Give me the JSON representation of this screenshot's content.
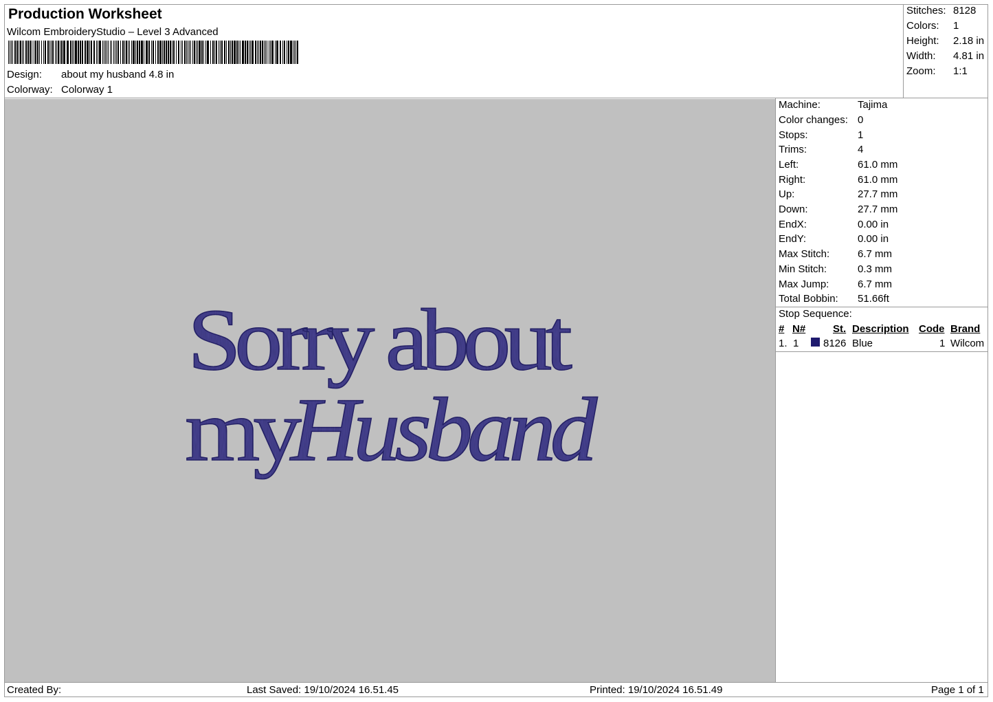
{
  "header": {
    "title": "Production Worksheet",
    "software": "Wilcom EmbroideryStudio – Level 3 Advanced",
    "design_label": "Design:",
    "design_value": "about my husband 4.8 in",
    "colorway_label": "Colorway:",
    "colorway_value": "Colorway 1"
  },
  "summary": [
    {
      "label": "Stitches:",
      "value": "8128"
    },
    {
      "label": "Colors:",
      "value": "1"
    },
    {
      "label": "Height:",
      "value": "2.18 in"
    },
    {
      "label": "Width:",
      "value": "4.81 in"
    },
    {
      "label": "Zoom:",
      "value": "1:1"
    }
  ],
  "details": [
    {
      "label": "Machine:",
      "value": "Tajima"
    },
    {
      "label": "Color changes:",
      "value": "0"
    },
    {
      "label": "Stops:",
      "value": "1"
    },
    {
      "label": "Trims:",
      "value": "4"
    },
    {
      "label": "Left:",
      "value": "61.0 mm"
    },
    {
      "label": "Right:",
      "value": "61.0 mm"
    },
    {
      "label": "Up:",
      "value": "27.7 mm"
    },
    {
      "label": "Down:",
      "value": "27.7 mm"
    },
    {
      "label": "EndX:",
      "value": "0.00 in"
    },
    {
      "label": "EndY:",
      "value": "0.00 in"
    },
    {
      "label": "Max Stitch:",
      "value": "6.7 mm"
    },
    {
      "label": "Min Stitch:",
      "value": "0.3 mm"
    },
    {
      "label": "Max Jump:",
      "value": "6.7 mm"
    },
    {
      "label": "Total Bobbin:",
      "value": "51.66ft"
    }
  ],
  "stop_sequence": {
    "title": "Stop Sequence:",
    "columns": [
      "#",
      "N#",
      "St.",
      "Description",
      "Code",
      "Brand"
    ],
    "rows": [
      {
        "num": "1.",
        "n": "1",
        "swatch": "#1f1a6e",
        "st": "8126",
        "description": "Blue",
        "code": "1",
        "brand": "Wilcom"
      }
    ]
  },
  "design": {
    "line1": "Sorry about",
    "line2_a": "my",
    "line2_b": "Husband",
    "thread_color": "#4a4494",
    "background": "#c0c0c0"
  },
  "footer": {
    "created_by": "Created By:",
    "last_saved": "Last Saved: 19/10/2024 16.51.45",
    "printed": "Printed: 19/10/2024 16.51.49",
    "page": "Page 1 of 1"
  }
}
